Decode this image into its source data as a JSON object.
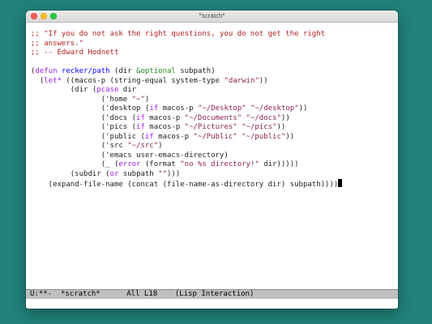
{
  "window": {
    "title": "*scratch*"
  },
  "buffer": {
    "lines": [
      [
        {
          "t": ";; \"If you do not ask the right questions, you do not get the right",
          "c": "c"
        }
      ],
      [
        {
          "t": ";; answers.\"",
          "c": "c"
        }
      ],
      [
        {
          "t": ";; -- Edward Hodnett",
          "c": "c"
        }
      ],
      [
        {
          "t": "",
          "c": ""
        }
      ],
      [
        {
          "t": "(",
          "c": ""
        },
        {
          "t": "defun",
          "c": "k"
        },
        {
          "t": " ",
          "c": ""
        },
        {
          "t": "recker/path",
          "c": "f"
        },
        {
          "t": " (dir ",
          "c": ""
        },
        {
          "t": "&optional",
          "c": "t"
        },
        {
          "t": " subpath)",
          "c": ""
        }
      ],
      [
        {
          "t": "  (",
          "c": ""
        },
        {
          "t": "let*",
          "c": "k"
        },
        {
          "t": " ((macos-p (string-equal system-type ",
          "c": ""
        },
        {
          "t": "\"darwin\"",
          "c": "s"
        },
        {
          "t": "))",
          "c": ""
        }
      ],
      [
        {
          "t": "         (dir (",
          "c": ""
        },
        {
          "t": "pcase",
          "c": "k"
        },
        {
          "t": " dir",
          "c": ""
        }
      ],
      [
        {
          "t": "                (",
          "c": ""
        },
        {
          "t": "'home",
          "c": ""
        },
        {
          "t": " ",
          "c": ""
        },
        {
          "t": "\"~\"",
          "c": "s"
        },
        {
          "t": ")",
          "c": ""
        }
      ],
      [
        {
          "t": "                ('desktop (",
          "c": ""
        },
        {
          "t": "if",
          "c": "k"
        },
        {
          "t": " macos-p ",
          "c": ""
        },
        {
          "t": "\"~/Desktop\"",
          "c": "s"
        },
        {
          "t": " ",
          "c": ""
        },
        {
          "t": "\"~/desktop\"",
          "c": "s"
        },
        {
          "t": "))",
          "c": ""
        }
      ],
      [
        {
          "t": "                ('docs (",
          "c": ""
        },
        {
          "t": "if",
          "c": "k"
        },
        {
          "t": " macos-p ",
          "c": ""
        },
        {
          "t": "\"~/Documents\"",
          "c": "s"
        },
        {
          "t": " ",
          "c": ""
        },
        {
          "t": "\"~/docs\"",
          "c": "s"
        },
        {
          "t": "))",
          "c": ""
        }
      ],
      [
        {
          "t": "                ('pics (",
          "c": ""
        },
        {
          "t": "if",
          "c": "k"
        },
        {
          "t": " macos-p ",
          "c": ""
        },
        {
          "t": "\"~/Pictures\"",
          "c": "s"
        },
        {
          "t": " ",
          "c": ""
        },
        {
          "t": "\"~/pics\"",
          "c": "s"
        },
        {
          "t": "))",
          "c": ""
        }
      ],
      [
        {
          "t": "                ('public (",
          "c": ""
        },
        {
          "t": "if",
          "c": "k"
        },
        {
          "t": " macos-p ",
          "c": ""
        },
        {
          "t": "\"~/Public\"",
          "c": "s"
        },
        {
          "t": " ",
          "c": ""
        },
        {
          "t": "\"~/public\"",
          "c": "s"
        },
        {
          "t": "))",
          "c": ""
        }
      ],
      [
        {
          "t": "                ('src ",
          "c": ""
        },
        {
          "t": "\"~/src\"",
          "c": "s"
        },
        {
          "t": ")",
          "c": ""
        }
      ],
      [
        {
          "t": "                ('emacs user-emacs-directory)",
          "c": ""
        }
      ],
      [
        {
          "t": "                (_ (",
          "c": ""
        },
        {
          "t": "error",
          "c": "e"
        },
        {
          "t": " (format ",
          "c": ""
        },
        {
          "t": "\"no %s directory!\"",
          "c": "s"
        },
        {
          "t": " dir)))))",
          "c": ""
        }
      ],
      [
        {
          "t": "         (subdir (",
          "c": ""
        },
        {
          "t": "or",
          "c": "k"
        },
        {
          "t": " subpath ",
          "c": ""
        },
        {
          "t": "\"\"",
          "c": "s"
        },
        {
          "t": ")))",
          "c": ""
        }
      ],
      [
        {
          "t": "    (expand-file-name (concat (file-name-as-directory dir) subpath))))",
          "c": ""
        }
      ]
    ]
  },
  "modeline": {
    "status": "U:**-",
    "buffer_name": "*scratch*",
    "position": "All L18",
    "mode": "(Lisp Interaction)"
  },
  "colors": {
    "comment": "#b22222",
    "keyword": "#a020f0",
    "function_name": "#0000ff",
    "string": "#8b2252",
    "type": "#228b22",
    "desktop_background": "#21827a",
    "modeline_background": "#bfbfbf"
  }
}
